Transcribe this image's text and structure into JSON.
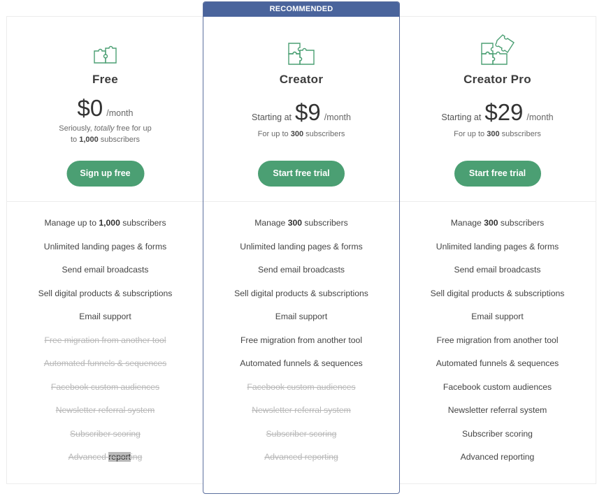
{
  "ribbon": "RECOMMENDED",
  "colors": {
    "accent_green": "#4b9f73",
    "ribbon_blue": "#4a649c"
  },
  "plans": [
    {
      "name": "Free",
      "icon": "puzzle-2-pieces-icon",
      "starting": "",
      "price": "$0",
      "per": "/month",
      "sub_pre": "Seriously, ",
      "sub_em": "totally",
      "sub_mid": " free for up",
      "sub_line2_pre": "to ",
      "sub_bold": "1,000",
      "sub_post": " subscribers",
      "cta": "Sign up free",
      "features": [
        {
          "pre": "Manage up to ",
          "bold": "1,000",
          "post": " subscribers",
          "included": true
        },
        {
          "pre": "Unlimited landing pages & forms",
          "bold": "",
          "post": "",
          "included": true
        },
        {
          "pre": "Send email broadcasts",
          "bold": "",
          "post": "",
          "included": true
        },
        {
          "pre": "Sell digital products & subscriptions",
          "bold": "",
          "post": "",
          "included": true
        },
        {
          "pre": "Email support",
          "bold": "",
          "post": "",
          "included": true
        },
        {
          "pre": "Free migration from another tool",
          "bold": "",
          "post": "",
          "included": false
        },
        {
          "pre": "Automated funnels & sequences",
          "bold": "",
          "post": "",
          "included": false
        },
        {
          "pre": "Facebook custom audiences",
          "bold": "",
          "post": "",
          "included": false
        },
        {
          "pre": "Newsletter referral system",
          "bold": "",
          "post": "",
          "included": false
        },
        {
          "pre": "Subscriber scoring",
          "bold": "",
          "post": "",
          "included": false
        },
        {
          "pre": "Advanced ",
          "bold": "report",
          "post": "ing",
          "included": false,
          "highlight": "report"
        }
      ]
    },
    {
      "name": "Creator",
      "icon": "puzzle-3-pieces-icon",
      "starting": "Starting at",
      "price": "$9",
      "per": "/month",
      "sub_pre": "For up to ",
      "sub_bold": "300",
      "sub_post": " subscribers",
      "cta": "Start free trial",
      "features": [
        {
          "pre": "Manage ",
          "bold": "300",
          "post": " subscribers",
          "included": true
        },
        {
          "pre": "Unlimited landing pages & forms",
          "bold": "",
          "post": "",
          "included": true
        },
        {
          "pre": "Send email broadcasts",
          "bold": "",
          "post": "",
          "included": true
        },
        {
          "pre": "Sell digital products & subscriptions",
          "bold": "",
          "post": "",
          "included": true
        },
        {
          "pre": "Email support",
          "bold": "",
          "post": "",
          "included": true
        },
        {
          "pre": "Free migration from another tool",
          "bold": "",
          "post": "",
          "included": true
        },
        {
          "pre": "Automated funnels & sequences",
          "bold": "",
          "post": "",
          "included": true
        },
        {
          "pre": "Facebook custom audiences",
          "bold": "",
          "post": "",
          "included": false
        },
        {
          "pre": "Newsletter referral system",
          "bold": "",
          "post": "",
          "included": false
        },
        {
          "pre": "Subscriber scoring",
          "bold": "",
          "post": "",
          "included": false
        },
        {
          "pre": "Advanced reporting",
          "bold": "",
          "post": "",
          "included": false
        }
      ]
    },
    {
      "name": "Creator Pro",
      "icon": "puzzle-4-pieces-icon",
      "starting": "Starting at",
      "price": "$29",
      "per": "/month",
      "sub_pre": "For up to ",
      "sub_bold": "300",
      "sub_post": " subscribers",
      "cta": "Start free trial",
      "features": [
        {
          "pre": "Manage ",
          "bold": "300",
          "post": " subscribers",
          "included": true
        },
        {
          "pre": "Unlimited landing pages & forms",
          "bold": "",
          "post": "",
          "included": true
        },
        {
          "pre": "Send email broadcasts",
          "bold": "",
          "post": "",
          "included": true
        },
        {
          "pre": "Sell digital products & subscriptions",
          "bold": "",
          "post": "",
          "included": true
        },
        {
          "pre": "Email support",
          "bold": "",
          "post": "",
          "included": true
        },
        {
          "pre": "Free migration from another tool",
          "bold": "",
          "post": "",
          "included": true
        },
        {
          "pre": "Automated funnels & sequences",
          "bold": "",
          "post": "",
          "included": true
        },
        {
          "pre": "Facebook custom audiences",
          "bold": "",
          "post": "",
          "included": true
        },
        {
          "pre": "Newsletter referral system",
          "bold": "",
          "post": "",
          "included": true
        },
        {
          "pre": "Subscriber scoring",
          "bold": "",
          "post": "",
          "included": true
        },
        {
          "pre": "Advanced reporting",
          "bold": "",
          "post": "",
          "included": true
        }
      ]
    }
  ]
}
